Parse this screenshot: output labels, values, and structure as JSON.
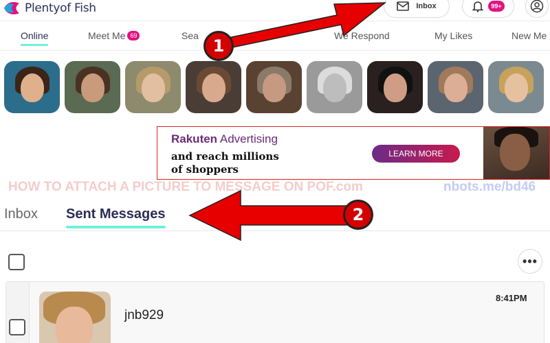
{
  "header": {
    "logo_text": "Plentyof Fish",
    "inbox_label": "Inbox",
    "notification_badge": "99+"
  },
  "nav": {
    "items": [
      {
        "label": "Online",
        "active": true
      },
      {
        "label": "Meet Me",
        "badge": "69"
      },
      {
        "label": "Sea"
      },
      {
        "label": "We Respond"
      },
      {
        "label": "My Likes"
      },
      {
        "label": "New Me"
      }
    ]
  },
  "photo_strip": {
    "count": 9
  },
  "ad": {
    "brand_bold": "Rakuten",
    "brand_rest": " Advertising",
    "copy_line1": "and reach millions",
    "copy_line2": "of shoppers",
    "cta": "LEARN MORE"
  },
  "watermark": {
    "left": "HOW TO ATTACH A PICTURE TO MESSAGE ON POF.com",
    "right": "nbots.me/bd46"
  },
  "messages": {
    "tabs": [
      {
        "label": "Inbox",
        "active": false
      },
      {
        "label": "Sent Messages",
        "active": true
      }
    ],
    "more_label": "•••",
    "conversations": [
      {
        "name": "jnb929",
        "time": "8:41PM"
      }
    ]
  },
  "annotations": {
    "step1": "1",
    "step2": "2",
    "arrow_color": "#e60000"
  }
}
